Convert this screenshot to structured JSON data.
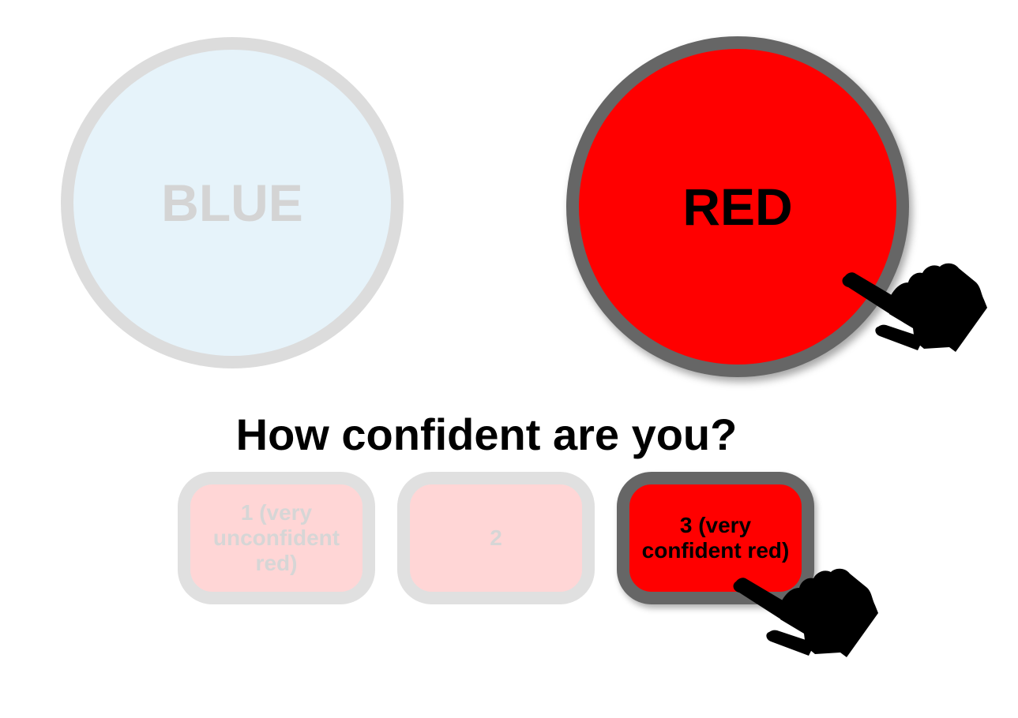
{
  "options": {
    "blue_label": "BLUE",
    "red_label": "RED"
  },
  "question": "How confident are you?",
  "ratings": [
    {
      "label": "1 (very unconfident red)"
    },
    {
      "label": "2"
    },
    {
      "label": "3 (very confident red)"
    }
  ],
  "selected": {
    "choice": "RED",
    "rating": "3 (very confident red)"
  },
  "colors": {
    "blue_fill_faded": "#e6f3fa",
    "red_fill": "#ff0000",
    "red_fill_faded": "#ffd6d6",
    "selected_border": "#666666",
    "unselected_border": "#dcdcdc"
  },
  "icons": {
    "cursor": "pointing-hand-icon"
  }
}
